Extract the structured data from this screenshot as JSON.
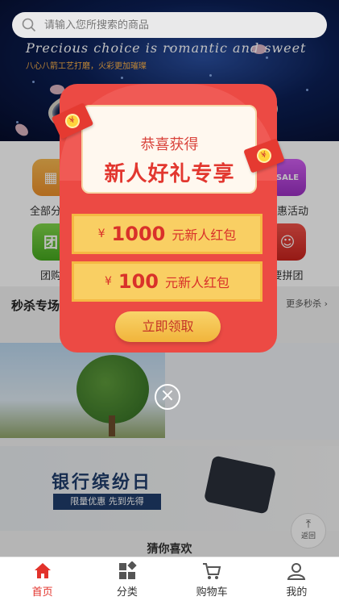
{
  "search": {
    "placeholder": "请输入您所搜索的商品"
  },
  "banner": {
    "title": "Precious choice is romantic and sweet",
    "subtitle": "八心八箭工艺打磨，火彩更加璀璨"
  },
  "categories": [
    {
      "label": "全部分类",
      "icon": "grid-icon",
      "color": "#f0a13b"
    },
    {
      "label": "团购",
      "icon": "group-icon",
      "color": "#5cc22c"
    },
    {
      "label": "优惠活动",
      "icon": "sale-icon",
      "color": "#b63fd6"
    },
    {
      "label": "要拼团",
      "icon": "people-icon",
      "color": "#e0342d"
    }
  ],
  "seckill": {
    "title": "秒杀专场",
    "more": "更多秒杀 ›"
  },
  "bank": {
    "title": "银行缤纷日",
    "subtitle": "限量优惠 先到先得"
  },
  "guess": {
    "title": "猜你喜欢"
  },
  "back_top": {
    "label": "返回"
  },
  "popup": {
    "subtitle": "恭喜获得",
    "title": "新人好礼专享",
    "coupons": [
      {
        "currency": "¥",
        "amount": "1000",
        "text": "元新人红包"
      },
      {
        "currency": "¥",
        "amount": "100",
        "text": "元新人红包"
      }
    ],
    "claim_label": "立即领取",
    "close_symbol": "×"
  },
  "nav": [
    {
      "label": "首页",
      "icon": "home-icon",
      "active": true
    },
    {
      "label": "分类",
      "icon": "category-icon",
      "active": false
    },
    {
      "label": "购物车",
      "icon": "cart-icon",
      "active": false
    },
    {
      "label": "我的",
      "icon": "user-icon",
      "active": false
    }
  ],
  "colors": {
    "accent": "#e2322b",
    "coupon": "#f9cf63",
    "envelope": "#ec4a44"
  }
}
